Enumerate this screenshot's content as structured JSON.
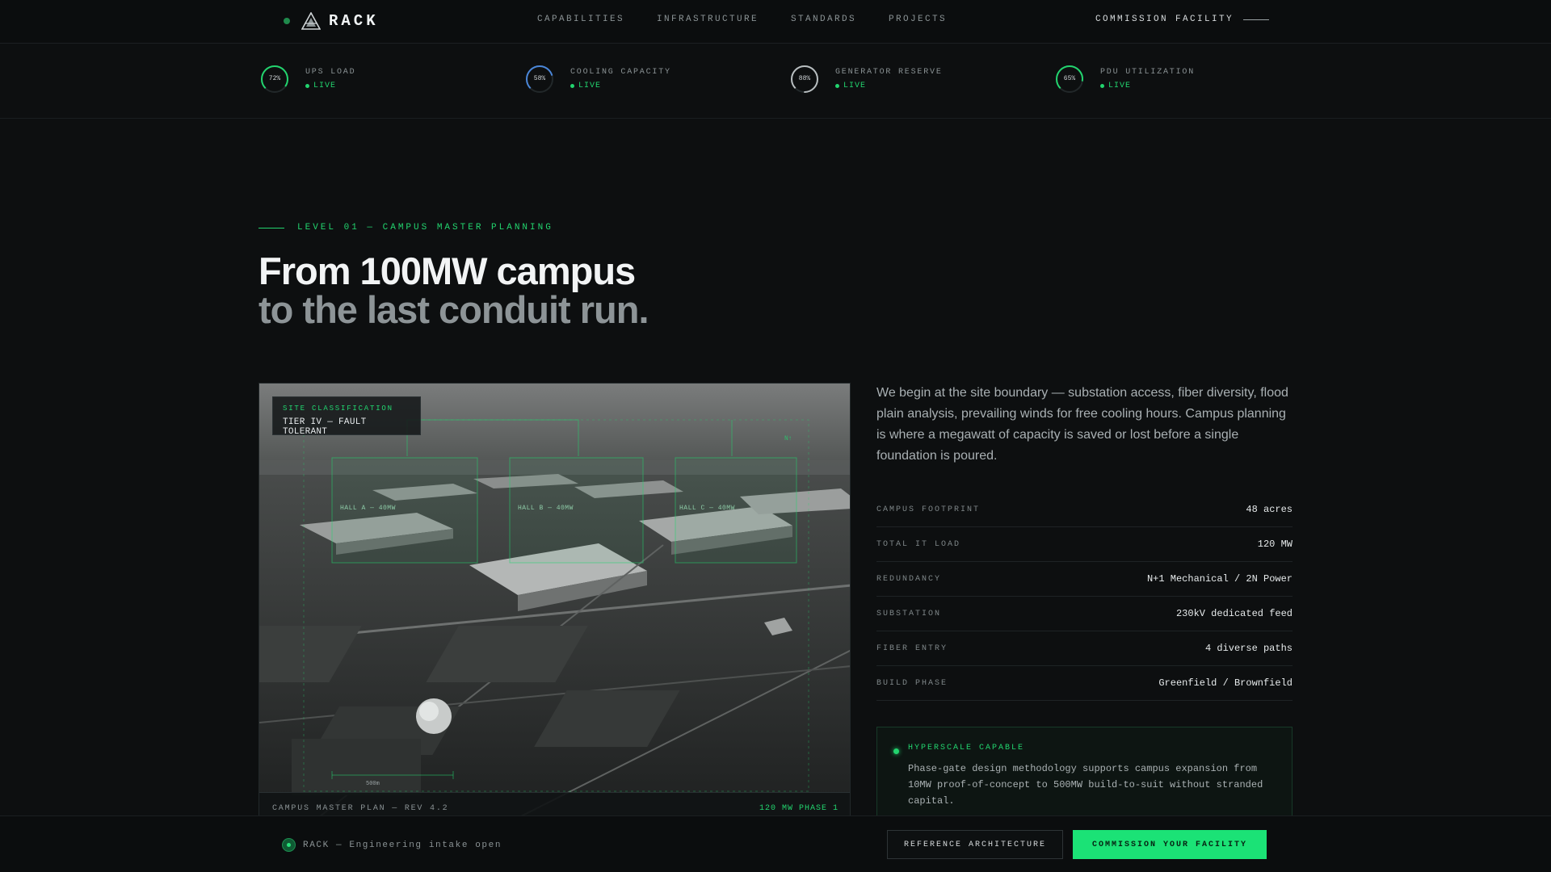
{
  "brand": {
    "name": "RACK"
  },
  "nav": {
    "items": [
      {
        "label": "CAPABILITIES"
      },
      {
        "label": "INFRASTRUCTURE"
      },
      {
        "label": "STANDARDS"
      },
      {
        "label": "PROJECTS"
      }
    ],
    "cta": "COMMISSION FACILITY"
  },
  "metrics": [
    {
      "label": "UPS LOAD",
      "percent": 72,
      "percent_label": "72%",
      "status": "LIVE",
      "color": "#22d46e"
    },
    {
      "label": "COOLING CAPACITY",
      "percent": 58,
      "percent_label": "58%",
      "status": "LIVE",
      "color": "#4a86d8"
    },
    {
      "label": "GENERATOR RESERVE",
      "percent": 88,
      "percent_label": "88%",
      "status": "LIVE",
      "color": "#b8bec0"
    },
    {
      "label": "PDU UTILIZATION",
      "percent": 65,
      "percent_label": "65%",
      "status": "LIVE",
      "color": "#22d46e"
    }
  ],
  "hero": {
    "eyebrow": "LEVEL 01 — CAMPUS MASTER PLANNING",
    "headline_line1": "From 100MW campus",
    "headline_line2": "to the last conduit run."
  },
  "panel": {
    "badge_key": "SITE CLASSIFICATION",
    "badge_value": "TIER IV — FAULT TOLERANT",
    "hall_labels": [
      "HALL A — 40MW",
      "HALL B — 40MW",
      "HALL C — 40MW"
    ],
    "north_marker": "N↑",
    "scale_label": "500m",
    "footer_left": "CAMPUS MASTER PLAN — REV 4.2",
    "footer_right": "120 MW PHASE 1"
  },
  "intro": "We begin at the site boundary — substation access, fiber diversity, flood plain analysis, prevailing winds for free cooling hours. Campus planning is where a megawatt of capacity is saved or lost before a single foundation is poured.",
  "specs": [
    {
      "key": "CAMPUS FOOTPRINT",
      "value": "48 acres"
    },
    {
      "key": "TOTAL IT LOAD",
      "value": "120 MW"
    },
    {
      "key": "REDUNDANCY",
      "value": "N+1 Mechanical / 2N Power"
    },
    {
      "key": "SUBSTATION",
      "value": "230kV dedicated feed"
    },
    {
      "key": "FIBER ENTRY",
      "value": "4 diverse paths"
    },
    {
      "key": "BUILD PHASE",
      "value": "Greenfield / Brownfield"
    }
  ],
  "callout": {
    "title": "HYPERSCALE CAPABLE",
    "body": "Phase-gate design methodology supports campus expansion from 10MW proof-of-concept to 500MW build-to-suit without stranded capital."
  },
  "bottom_bar": {
    "intake": "RACK — Engineering intake open",
    "secondary_button": "REFERENCE ARCHITECTURE",
    "primary_button": "COMMISSION YOUR FACILITY"
  }
}
